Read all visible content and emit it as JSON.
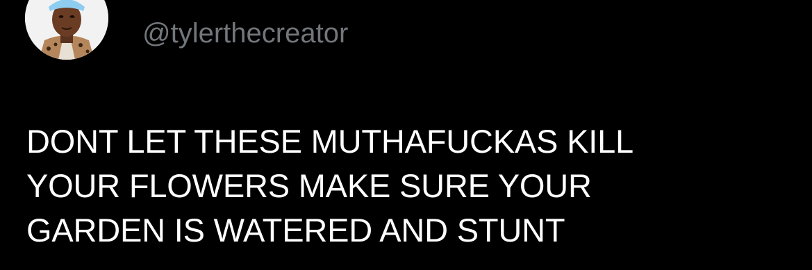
{
  "tweet": {
    "author": {
      "handle": "@tylerthecreator",
      "avatar_icon": "profile-photo"
    },
    "text_lines": [
      "DONT LET THESE MUTHAFUCKAS KILL",
      "YOUR FLOWERS MAKE SURE YOUR",
      "GARDEN IS WATERED AND STUNT"
    ]
  },
  "colors": {
    "background": "#000000",
    "text": "#ffffff",
    "handle": "#71767b",
    "accent": "#8ecdf0"
  }
}
